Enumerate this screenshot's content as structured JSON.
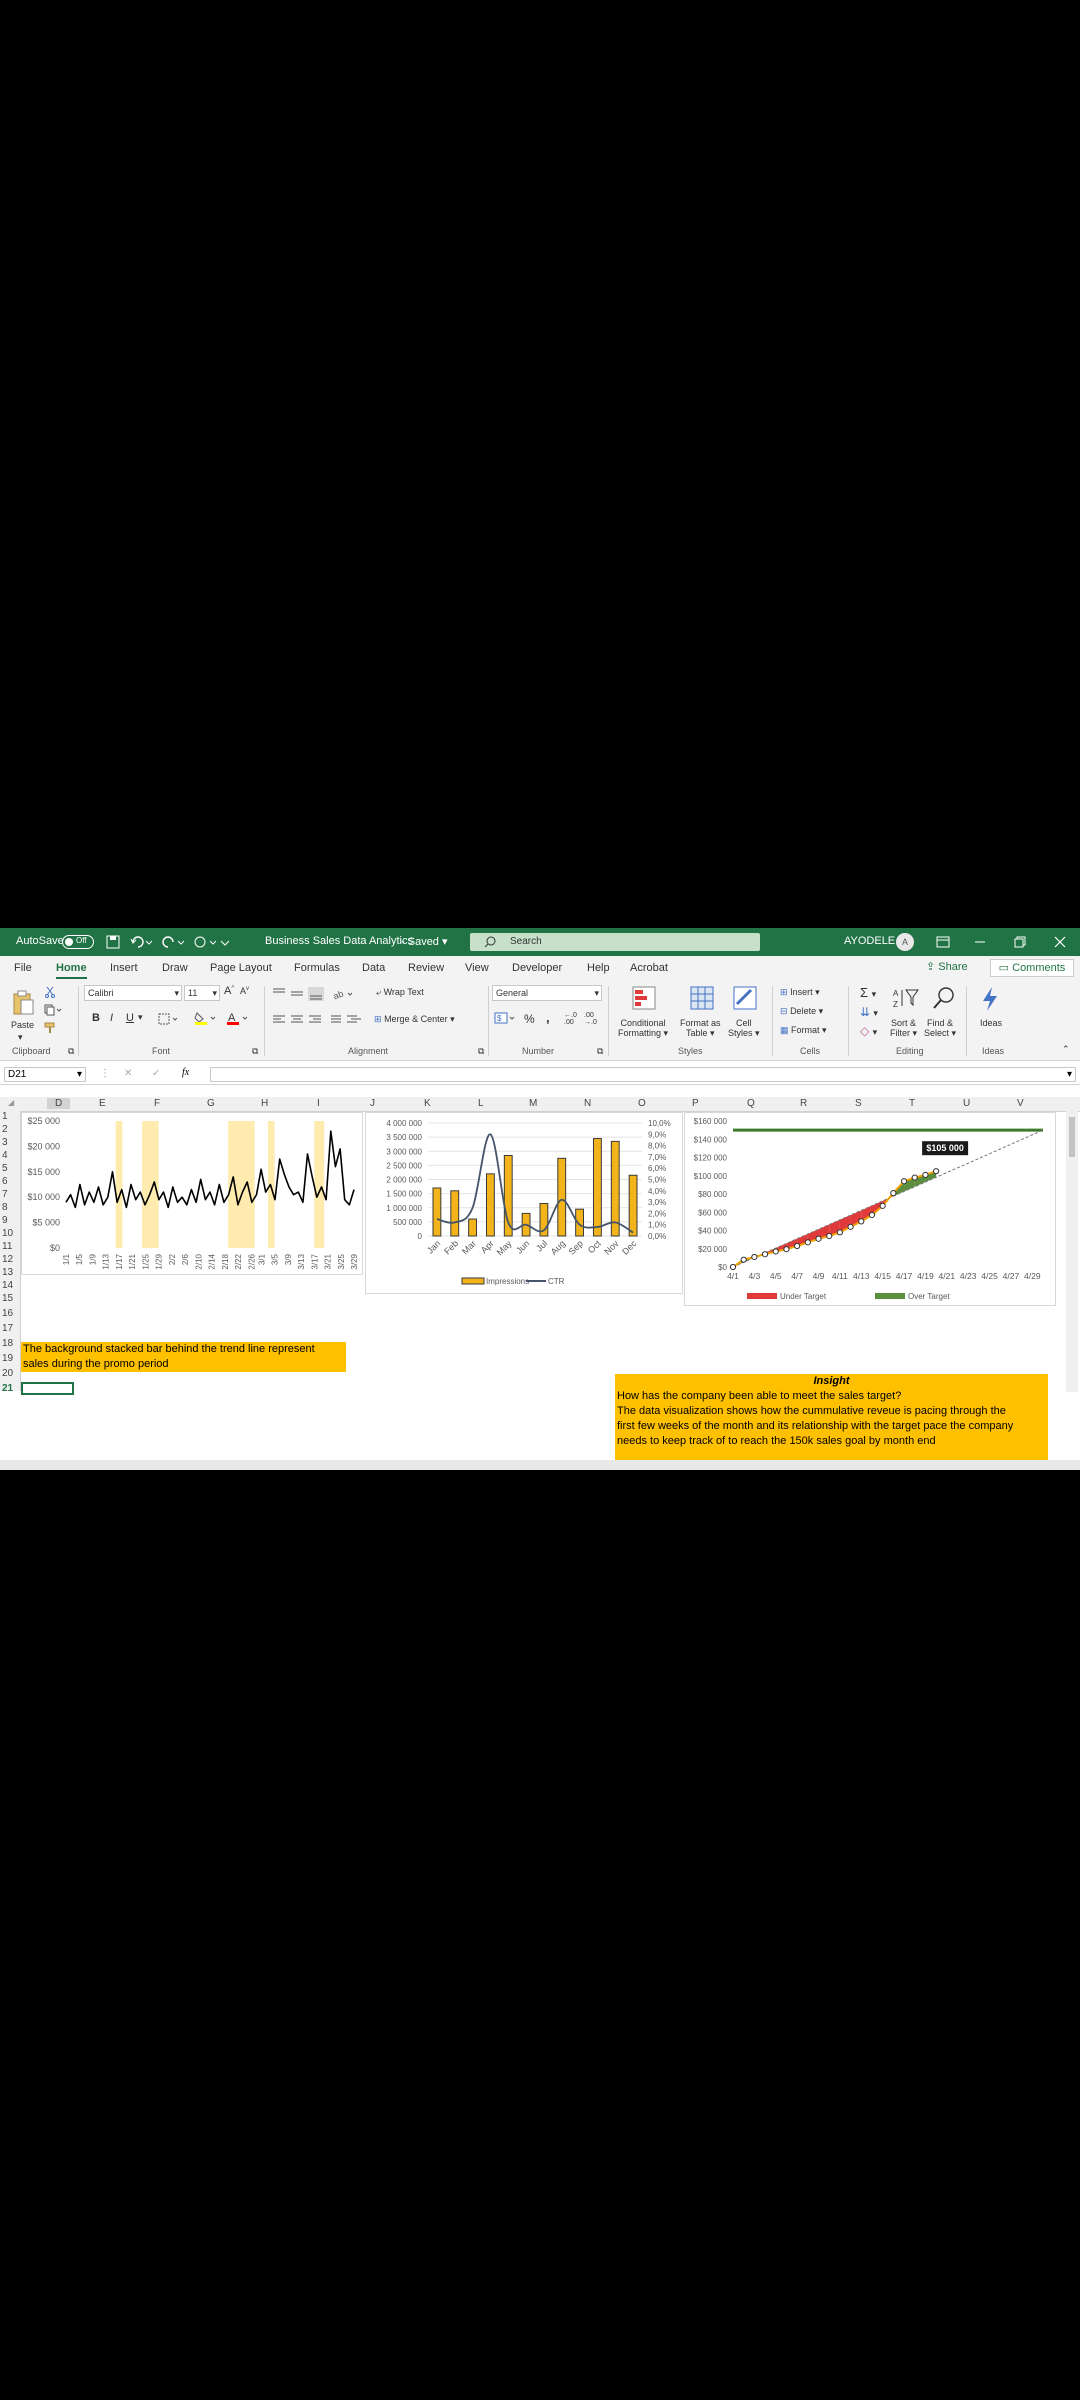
{
  "titlebar": {
    "autosave_label": "AutoSave",
    "autosave_state": "Off",
    "doc_title": "Business Sales Data Analytics",
    "saved_status": "Saved",
    "search_placeholder": "Search",
    "user_name": "AYODELE",
    "user_initial": "A"
  },
  "tabs": [
    "File",
    "Home",
    "Insert",
    "Draw",
    "Page Layout",
    "Formulas",
    "Data",
    "Review",
    "View",
    "Developer",
    "Help",
    "Acrobat"
  ],
  "active_tab": "Home",
  "share_label": "Share",
  "comments_label": "Comments",
  "ribbon": {
    "paste": "Paste",
    "font_name": "Calibri",
    "font_size": "11",
    "wrap_text": "Wrap Text",
    "merge_center": "Merge & Center",
    "number_format": "General",
    "conditional": [
      "Conditional",
      "Formatting"
    ],
    "format_table": [
      "Format as",
      "Table"
    ],
    "cell_styles": [
      "Cell",
      "Styles"
    ],
    "insert": "Insert",
    "delete": "Delete",
    "format": "Format",
    "sort_filter": [
      "Sort &",
      "Filter"
    ],
    "find_select": [
      "Find &",
      "Select"
    ],
    "ideas": "Ideas",
    "groups": [
      "Clipboard",
      "Font",
      "Alignment",
      "Number",
      "Styles",
      "Cells",
      "Editing",
      "Ideas"
    ]
  },
  "formula_bar": {
    "name_box": "D21",
    "fx": "fx",
    "formula": ""
  },
  "columns": [
    "D",
    "E",
    "F",
    "G",
    "H",
    "I",
    "J",
    "K",
    "L",
    "M",
    "N",
    "O",
    "P",
    "Q",
    "R",
    "S",
    "T",
    "U",
    "V"
  ],
  "rows": [
    "1",
    "2",
    "3",
    "4",
    "5",
    "6",
    "7",
    "8",
    "9",
    "10",
    "11",
    "12",
    "13",
    "14",
    "15",
    "16",
    "17",
    "18",
    "19",
    "20",
    "21"
  ],
  "notes": {
    "promo_line1": "The background stacked bar behind the trend line represent",
    "promo_line2": "sales during the promo period"
  },
  "insight": {
    "heading": "Insight",
    "question": "How has the company been able to meet the sales target?",
    "body1": "The data visualization shows how the cummulative reveue is pacing through the",
    "body2": "first few weeks of the month and its relationship with the target pace the company",
    "body3": "needs to keep track of to reach the 150k sales goal by month end"
  },
  "chart_data": [
    {
      "type": "line",
      "yticks": [
        "$25 000",
        "$20 000",
        "$15 000",
        "$10 000",
        "$5 000",
        "$0"
      ],
      "ylim": [
        0,
        25000
      ],
      "x": [
        "1/1",
        "1/5",
        "1/9",
        "1/13",
        "1/17",
        "1/21",
        "1/25",
        "1/29",
        "2/2",
        "2/6",
        "2/10",
        "2/14",
        "2/18",
        "2/22",
        "2/26",
        "3/1",
        "3/5",
        "3/9",
        "3/13",
        "3/17",
        "3/21",
        "3/25",
        "3/29"
      ],
      "series": [
        {
          "values": [
            9000,
            10500,
            8000,
            12500,
            8500,
            11000,
            9000,
            12000,
            8500,
            10000,
            15000,
            9000,
            11500,
            8000,
            12500,
            9500,
            11000,
            8500,
            10500,
            13000,
            9500,
            11000,
            8000,
            12000,
            9000,
            10000,
            8500,
            11500,
            9000,
            13500,
            9500,
            11000,
            8500,
            12500,
            9000,
            10500,
            14000,
            8500,
            11000,
            13000,
            9000,
            10500,
            15500,
            11000,
            12500,
            9500,
            17500,
            14500,
            12000,
            10500,
            11000,
            9000,
            18500,
            14000,
            10000,
            12000,
            9500,
            23000,
            16000,
            19500,
            9500,
            8500,
            11500
          ]
        }
      ],
      "promo_bands": [
        [
          "1/16",
          "1/18"
        ],
        [
          "1/24",
          "1/29"
        ],
        [
          "2/19",
          "2/27"
        ],
        [
          "3/3",
          "3/5"
        ],
        [
          "3/17",
          "3/20"
        ]
      ],
      "grid": false,
      "legend": "none"
    },
    {
      "type": "bar",
      "categories": [
        "Jan",
        "Feb",
        "Mar",
        "Apr",
        "May",
        "Jun",
        "Jul",
        "Aug",
        "Sep",
        "Oct",
        "Nov",
        "Dec"
      ],
      "series": [
        {
          "name": "Impressions",
          "type": "bar",
          "values": [
            1700000,
            1600000,
            600000,
            2200000,
            2850000,
            800000,
            1150000,
            2750000,
            950000,
            3450000,
            3350000,
            2150000
          ]
        },
        {
          "name": "CTR",
          "type": "line",
          "axis": "secondary",
          "values": [
            1.5,
            1.2,
            2.5,
            9.0,
            1.2,
            1.0,
            0.5,
            3.2,
            1.0,
            0.8,
            1.2,
            0.3
          ]
        }
      ],
      "yticks_left": [
        "4 000 000",
        "3 500 000",
        "3 000 000",
        "2 500 000",
        "2 000 000",
        "1 500 000",
        "1 000 000",
        "500 000",
        "0"
      ],
      "ylim_left": [
        0,
        4000000
      ],
      "yticks_right": [
        "10,0%",
        "9,0%",
        "8,0%",
        "7,0%",
        "6,0%",
        "5,0%",
        "4,0%",
        "3,0%",
        "2,0%",
        "1,0%",
        "0,0%"
      ],
      "ylim_right": [
        0,
        10
      ],
      "grid": true,
      "legend": "bottom"
    },
    {
      "type": "area",
      "x": [
        "4/1",
        "4/3",
        "4/5",
        "4/7",
        "4/9",
        "4/11",
        "4/13",
        "4/15",
        "4/17",
        "4/19",
        "4/21",
        "4/23",
        "4/25",
        "4/27",
        "4/29"
      ],
      "yticks": [
        "$160 000",
        "$140 000",
        "$120 000",
        "$100 000",
        "$80 000",
        "$60 000",
        "$40 000",
        "$20 000",
        "$0"
      ],
      "ylim": [
        0,
        160000
      ],
      "goal": 150000,
      "series": [
        {
          "name": "Under Target",
          "color": "#e03a3a"
        },
        {
          "name": "Over Target",
          "color": "#5b8f3e"
        }
      ],
      "revenue_days": [
        1,
        2,
        3,
        4,
        5,
        6,
        7,
        8,
        9,
        10,
        11,
        12,
        13,
        14,
        15,
        16,
        17,
        18,
        19,
        20
      ],
      "revenue_values": [
        0,
        8000,
        11000,
        14000,
        17000,
        19500,
        23000,
        27000,
        31000,
        34000,
        38000,
        44000,
        50000,
        57000,
        67000,
        81000,
        94000,
        98000,
        101000,
        105000
      ],
      "annotation": "$105 000",
      "grid": false,
      "legend": "bottom"
    }
  ]
}
